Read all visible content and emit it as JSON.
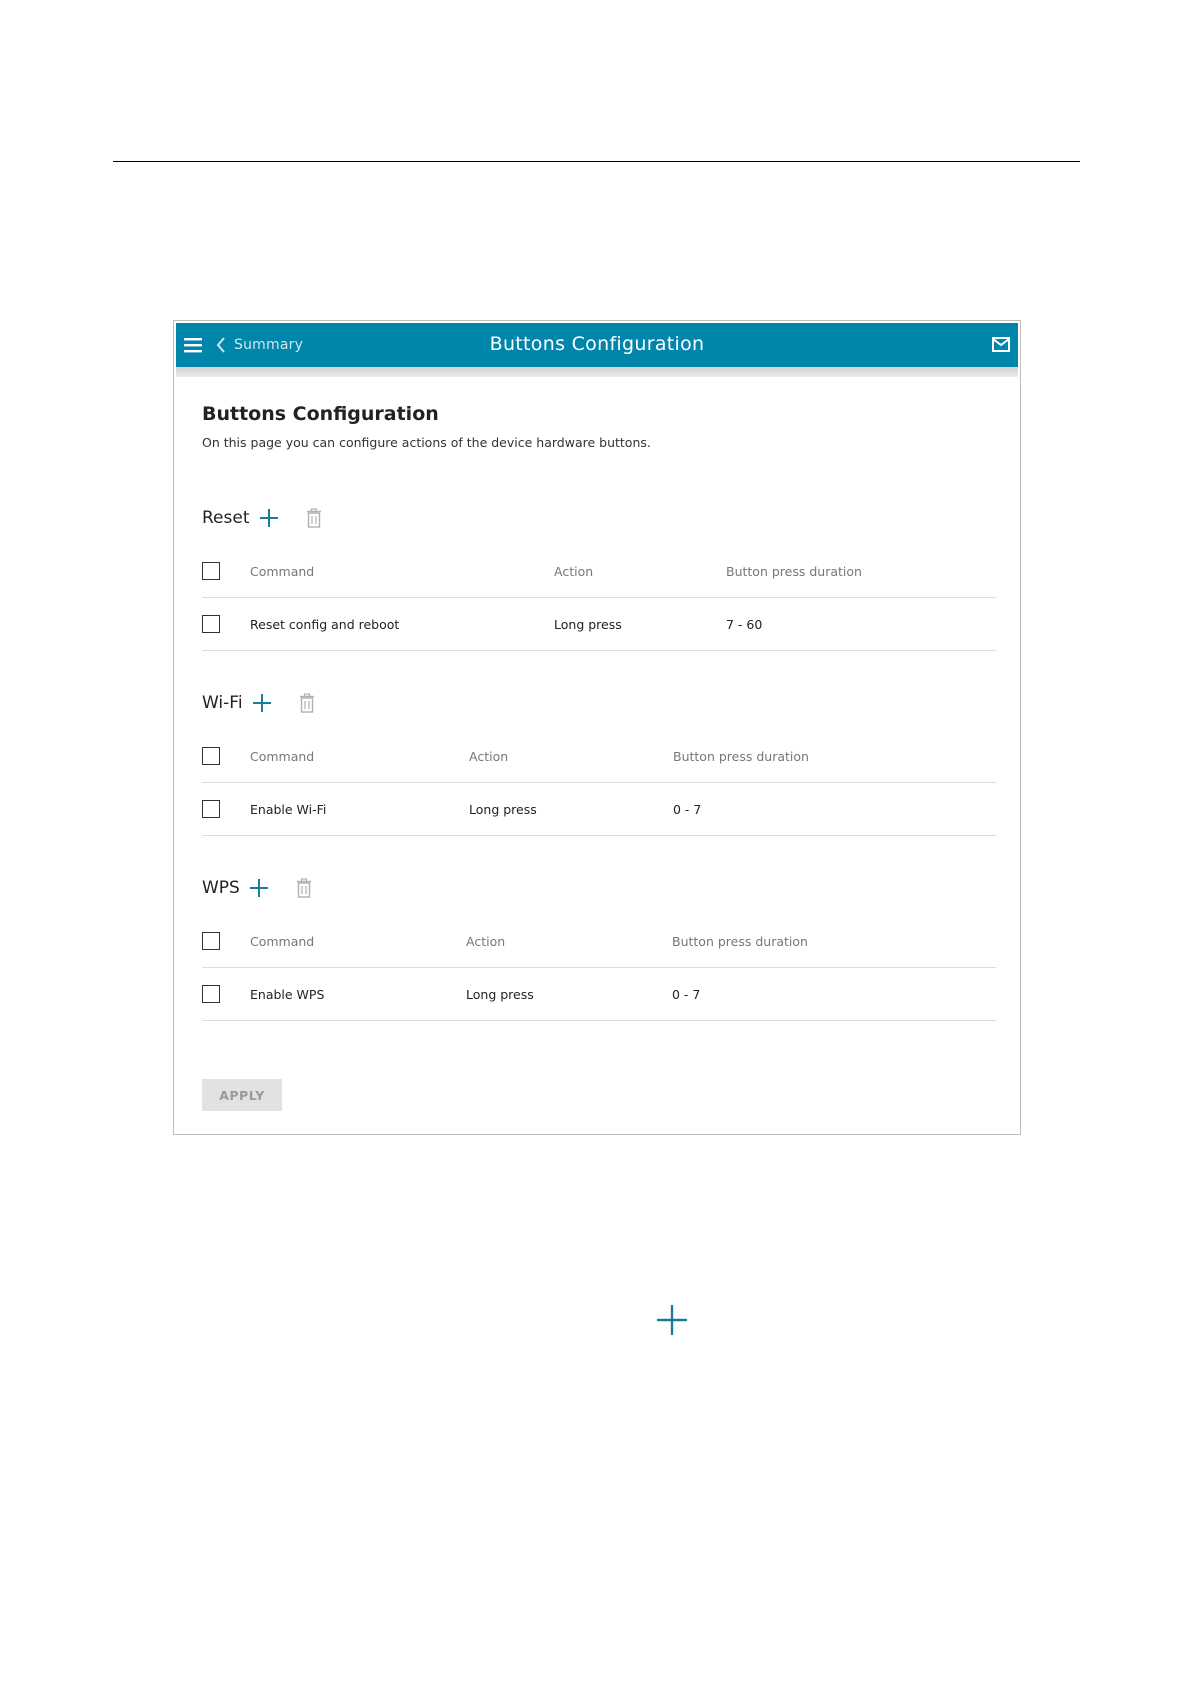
{
  "header": {
    "back_label": "Summary",
    "title": "Buttons Configuration",
    "icons": [
      "menu-icon",
      "chevron-left-icon",
      "notifications-icon"
    ]
  },
  "page": {
    "title": "Buttons Configuration",
    "description": "On this page you can configure actions of the device hardware buttons."
  },
  "columns": {
    "command": "Command",
    "action": "Action",
    "duration": "Button press duration"
  },
  "sections": [
    {
      "name": "Reset",
      "rows": [
        {
          "command": "Reset config and reboot",
          "action": "Long press",
          "duration": "7 - 60"
        }
      ]
    },
    {
      "name": "Wi-Fi",
      "rows": [
        {
          "command": "Enable Wi-Fi",
          "action": "Long press",
          "duration": "0 - 7"
        }
      ]
    },
    {
      "name": "WPS",
      "rows": [
        {
          "command": "Enable WPS",
          "action": "Long press",
          "duration": "0 - 7"
        }
      ]
    }
  ],
  "apply_label": "APPLY",
  "colors": {
    "header_bg": "#0085ab",
    "accent": "#1a7f96",
    "apply_bg": "#e2e2e2",
    "apply_text": "#9a9a9a"
  }
}
